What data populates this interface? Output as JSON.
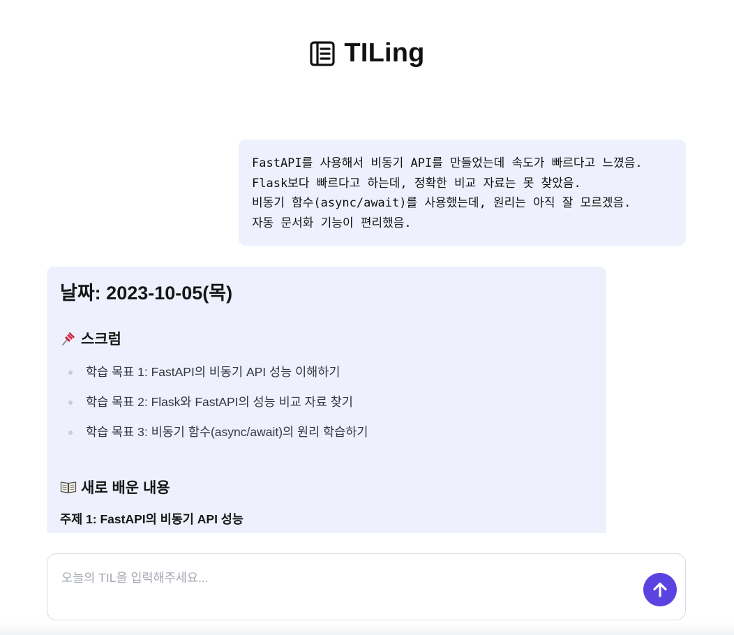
{
  "header": {
    "title": "TILing",
    "icon": "notebook-icon"
  },
  "user_message": {
    "lines": [
      "FastAPI를 사용해서 비동기 API를 만들었는데 속도가 빠르다고 느꼈음.",
      "Flask보다 빠르다고 하는데, 정확한 비교 자료는 못 찾았음.",
      "비동기 함수(async/await)를 사용했는데, 원리는 아직 잘 모르겠음.",
      "자동 문서화 기능이 편리했음."
    ]
  },
  "response": {
    "date_heading": "날짜: 2023-10-05(목)",
    "scrum": {
      "icon": "pushpin-icon",
      "heading": "스크럼",
      "goals": [
        "학습 목표 1: FastAPI의 비동기 API 성능 이해하기",
        "학습 목표 2: Flask와 FastAPI의 성능 비교 자료 찾기",
        "학습 목표 3: 비동기 함수(async/await)의 원리 학습하기"
      ]
    },
    "learned": {
      "icon": "open-book-icon",
      "heading": "새로 배운 내용",
      "topic_heading": "주제 1: FastAPI의 비동기 API 성능"
    }
  },
  "composer": {
    "placeholder": "오늘의 TIL을 입력해주세요...",
    "value": "",
    "send_icon": "arrow-up-icon"
  },
  "colors": {
    "bubble_background": "#eef1fd",
    "send_button": "#5b43e2",
    "text_primary": "#161616"
  }
}
